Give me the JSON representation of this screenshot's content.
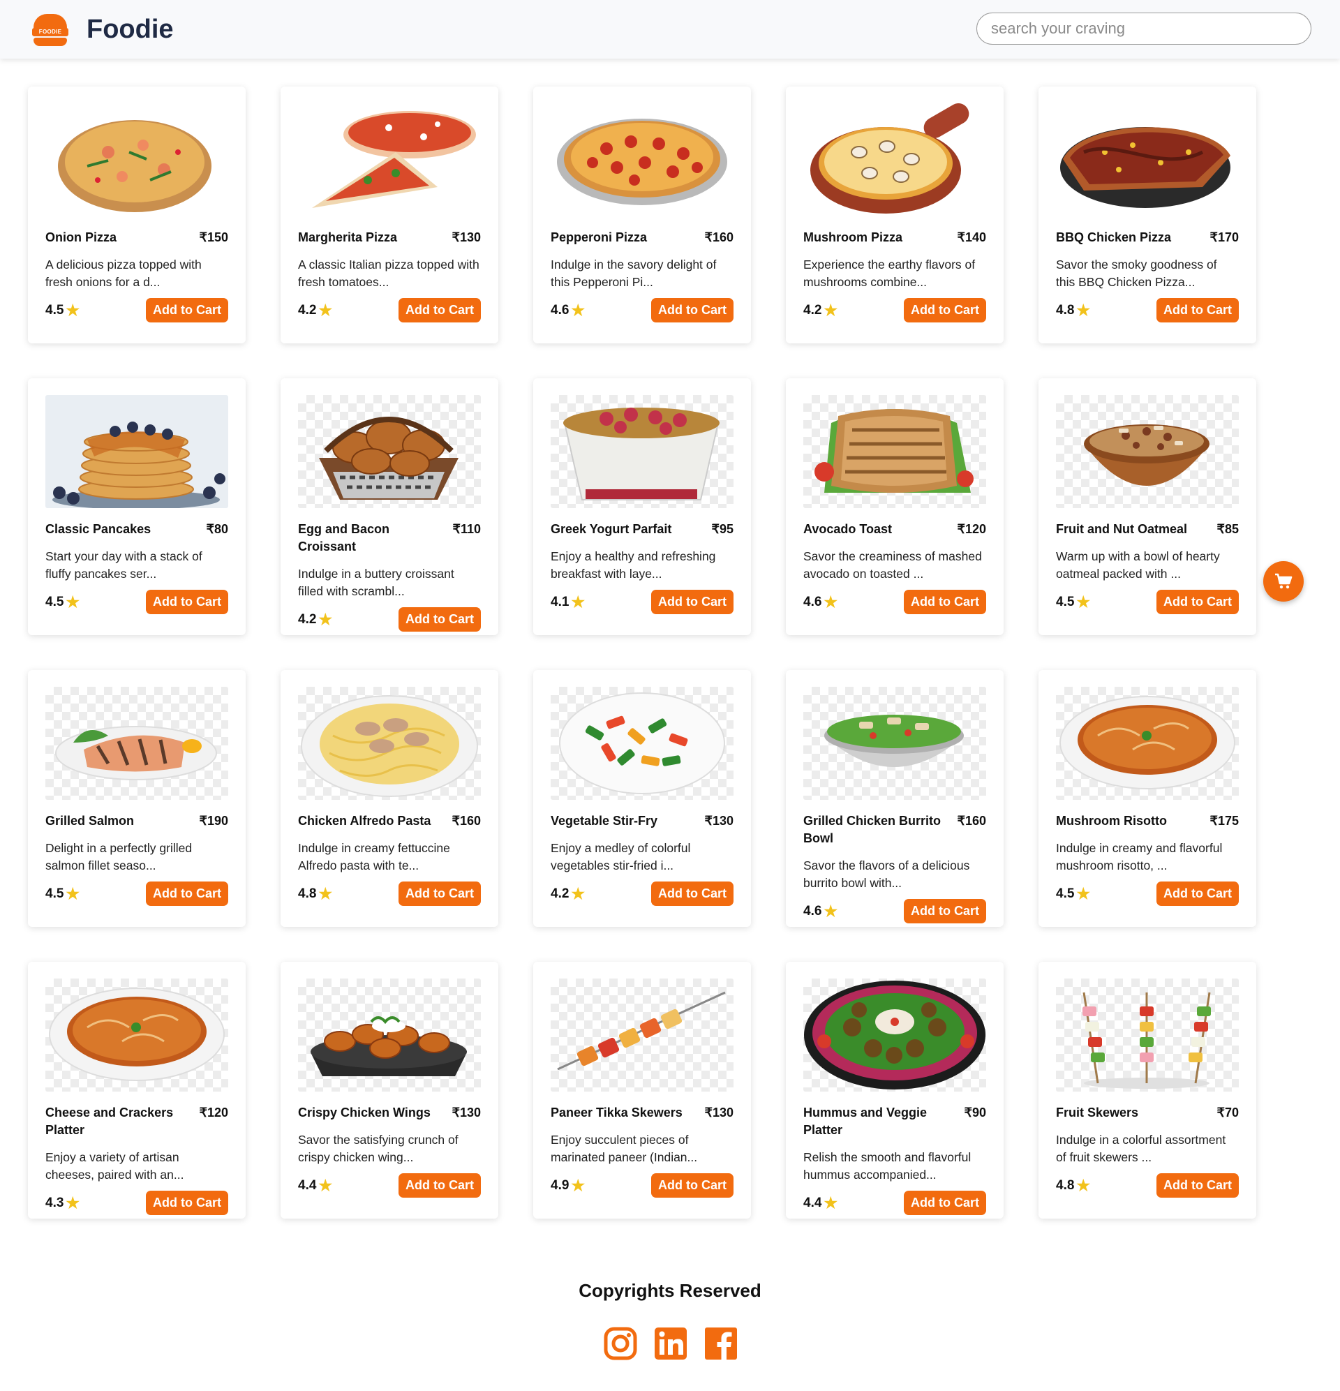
{
  "header": {
    "brand": "Foodie",
    "logo_text": "FOODIE",
    "search_placeholder": "search your craving"
  },
  "items": [
    {
      "name": "Onion Pizza",
      "price": "₹150",
      "desc": "A delicious pizza topped with fresh onions for a d...",
      "rating": "4.5",
      "cta": "Add to Cart",
      "image": "pizza-seafood",
      "bg": "plain"
    },
    {
      "name": "Margherita Pizza",
      "price": "₹130",
      "desc": "A classic Italian pizza topped with fresh tomatoes...",
      "rating": "4.2",
      "cta": "Add to Cart",
      "image": "pizza-margherita",
      "bg": "plain"
    },
    {
      "name": "Pepperoni Pizza",
      "price": "₹160",
      "desc": "Indulge in the savory delight of this Pepperoni Pi...",
      "rating": "4.6",
      "cta": "Add to Cart",
      "image": "pizza-pepperoni",
      "bg": "plain"
    },
    {
      "name": "Mushroom Pizza",
      "price": "₹140",
      "desc": "Experience the earthy flavors of mushrooms combine...",
      "rating": "4.2",
      "cta": "Add to Cart",
      "image": "pizza-mushroom",
      "bg": "plain"
    },
    {
      "name": "BBQ Chicken Pizza",
      "price": "₹170",
      "desc": "Savor the smoky goodness of this BBQ Chicken Pizza...",
      "rating": "4.8",
      "cta": "Add to Cart",
      "image": "pizza-bbq",
      "bg": "plain"
    },
    {
      "name": "Classic Pancakes",
      "price": "₹80",
      "desc": "Start your day with a stack of fluffy pancakes ser...",
      "rating": "4.5",
      "cta": "Add to Cart",
      "image": "pancakes",
      "bg": "plain"
    },
    {
      "name": "Egg and Bacon Croissant",
      "price": "₹110",
      "desc": "Indulge in a buttery croissant filled with scrambl...",
      "rating": "4.2",
      "cta": "Add to Cart",
      "image": "croissant-basket",
      "bg": "checker"
    },
    {
      "name": "Greek Yogurt Parfait",
      "price": "₹95",
      "desc": "Enjoy a healthy and refreshing breakfast with laye...",
      "rating": "4.1",
      "cta": "Add to Cart",
      "image": "yogurt-parfait",
      "bg": "checker"
    },
    {
      "name": "Avocado Toast",
      "price": "₹120",
      "desc": "Savor the creaminess of mashed avocado on toasted ...",
      "rating": "4.6",
      "cta": "Add to Cart",
      "image": "toast",
      "bg": "checker"
    },
    {
      "name": "Fruit and Nut Oatmeal",
      "price": "₹85",
      "desc": "Warm up with a bowl of hearty oatmeal packed with ...",
      "rating": "4.5",
      "cta": "Add to Cart",
      "image": "oatmeal-bowl",
      "bg": "checker"
    },
    {
      "name": "Grilled Salmon",
      "price": "₹190",
      "desc": "Delight in a perfectly grilled salmon fillet seaso...",
      "rating": "4.5",
      "cta": "Add to Cart",
      "image": "salmon-plate",
      "bg": "checker"
    },
    {
      "name": "Chicken Alfredo Pasta",
      "price": "₹160",
      "desc": "Indulge in creamy fettuccine Alfredo pasta with te...",
      "rating": "4.8",
      "cta": "Add to Cart",
      "image": "alfredo-pasta",
      "bg": "checker"
    },
    {
      "name": "Vegetable Stir-Fry",
      "price": "₹130",
      "desc": "Enjoy a medley of colorful vegetables stir-fried i...",
      "rating": "4.2",
      "cta": "Add to Cart",
      "image": "stir-fry",
      "bg": "checker"
    },
    {
      "name": "Grilled Chicken Burrito Bowl",
      "price": "₹160",
      "desc": "Savor the flavors of a delicious burrito bowl with...",
      "rating": "4.6",
      "cta": "Add to Cart",
      "image": "burrito-bowl",
      "bg": "checker"
    },
    {
      "name": "Mushroom Risotto",
      "price": "₹175",
      "desc": "Indulge in creamy and flavorful mushroom risotto, ...",
      "rating": "4.5",
      "cta": "Add to Cart",
      "image": "soup-bowl",
      "bg": "checker"
    },
    {
      "name": "Cheese and Crackers Platter",
      "price": "₹120",
      "desc": "Enjoy a variety of artisan cheeses, paired with an...",
      "rating": "4.3",
      "cta": "Add to Cart",
      "image": "soup-bowl",
      "bg": "checker"
    },
    {
      "name": "Crispy Chicken Wings",
      "price": "₹130",
      "desc": "Savor the satisfying crunch of crispy chicken wing...",
      "rating": "4.4",
      "cta": "Add to Cart",
      "image": "wings-tray",
      "bg": "checker"
    },
    {
      "name": "Paneer Tikka Skewers",
      "price": "₹130",
      "desc": "Enjoy succulent pieces of marinated paneer (Indian...",
      "rating": "4.9",
      "cta": "Add to Cart",
      "image": "tikka-skewer",
      "bg": "checker"
    },
    {
      "name": "Hummus and Veggie Platter",
      "price": "₹90",
      "desc": "Relish the smooth and flavorful hummus accompanied...",
      "rating": "4.4",
      "cta": "Add to Cart",
      "image": "hummus-platter",
      "bg": "checker"
    },
    {
      "name": "Fruit Skewers",
      "price": "₹70",
      "desc": "Indulge in a colorful assortment of fruit skewers ...",
      "rating": "4.8",
      "cta": "Add to Cart",
      "image": "fruit-skewers",
      "bg": "checker"
    }
  ],
  "footer": {
    "title": "Copyrights Reserved",
    "socials": [
      "instagram-icon",
      "linkedin-icon",
      "facebook-icon"
    ]
  },
  "floating_cart": {
    "icon": "cart-icon"
  },
  "colors": {
    "accent": "#f26b0f",
    "star": "#f2c21b",
    "brand_text": "#1f2a44"
  }
}
